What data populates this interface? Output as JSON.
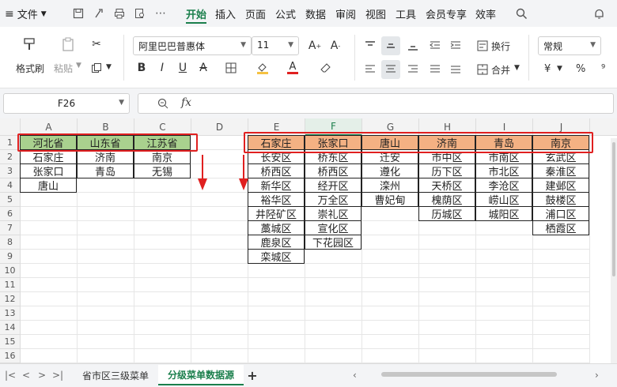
{
  "menubar": {
    "file_label": "文件",
    "tabs": [
      "开始",
      "插入",
      "页面",
      "公式",
      "数据",
      "审阅",
      "视图",
      "工具",
      "会员专享",
      "效率"
    ],
    "active_tab": "开始"
  },
  "ribbon": {
    "format_painter": "格式刷",
    "paste": "粘贴",
    "font_name": "阿里巴巴普惠体",
    "font_size": "11",
    "wrap": "换行",
    "merge": "合并",
    "number_format": "常规",
    "currency": "¥",
    "percent": "%"
  },
  "formula_bar": {
    "cell_ref": "F26",
    "fx": "fx",
    "value": ""
  },
  "columns": [
    {
      "label": "A",
      "selected": false
    },
    {
      "label": "B",
      "selected": false
    },
    {
      "label": "C",
      "selected": false
    },
    {
      "label": "D",
      "selected": false
    },
    {
      "label": "E",
      "selected": false
    },
    {
      "label": "F",
      "selected": true
    },
    {
      "label": "G",
      "selected": false
    },
    {
      "label": "H",
      "selected": false
    },
    {
      "label": "I",
      "selected": false
    },
    {
      "label": "J",
      "selected": false
    }
  ],
  "rows": [
    "1",
    "2",
    "3",
    "4",
    "5",
    "6",
    "7",
    "8",
    "9",
    "10",
    "11",
    "12",
    "13",
    "14",
    "15",
    "16"
  ],
  "provinces": {
    "headers": [
      "河北省",
      "山东省",
      "江苏省"
    ],
    "values": [
      [
        "石家庄",
        "济南",
        "南京"
      ],
      [
        "张家口",
        "青岛",
        "无锡"
      ],
      [
        "唐山",
        "",
        ""
      ]
    ]
  },
  "cities": {
    "headers": [
      "石家庄",
      "张家口",
      "唐山",
      "济南",
      "青岛",
      "南京"
    ],
    "columns": [
      [
        "长安区",
        "桥西区",
        "新华区",
        "裕华区",
        "井陉矿区",
        "藁城区",
        "鹿泉区",
        "栾城区"
      ],
      [
        "桥东区",
        "桥西区",
        "经开区",
        "万全区",
        "崇礼区",
        "宣化区",
        "下花园区"
      ],
      [
        "迁安",
        "遵化",
        "滦州",
        "曹妃甸"
      ],
      [
        "市中区",
        "历下区",
        "天桥区",
        "槐荫区",
        "历城区"
      ],
      [
        "市南区",
        "市北区",
        "李沧区",
        "崂山区",
        "城阳区"
      ],
      [
        "玄武区",
        "秦淮区",
        "建邺区",
        "鼓楼区",
        "浦口区",
        "栖霞区"
      ]
    ]
  },
  "sheets": {
    "tabs": [
      "省市区三级菜单",
      "分级菜单数据源"
    ],
    "active": "分级菜单数据源",
    "add": "+"
  },
  "colors": {
    "accent": "#1b7f4c",
    "green_header": "#a9d18e",
    "orange_header": "#f4b183",
    "annotation_red": "#e02020"
  }
}
